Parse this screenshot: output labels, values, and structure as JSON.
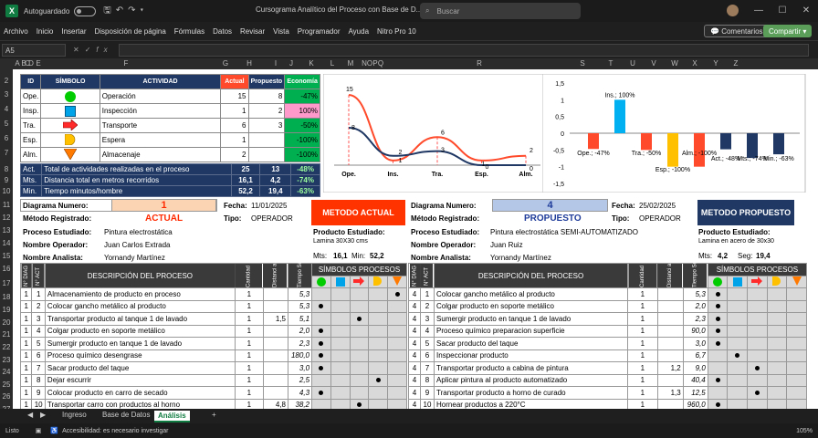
{
  "titlebar": {
    "autosave": "Autoguardado",
    "doc_title": "Cursograma Analítico del Proceso con Base de D...",
    "search": "Buscar"
  },
  "menu": [
    "Archivo",
    "Inicio",
    "Insertar",
    "Disposición de página",
    "Fórmulas",
    "Datos",
    "Revisar",
    "Vista",
    "Programador",
    "Ayuda",
    "Nitro Pro 10"
  ],
  "buttons": {
    "comments": "Comentarios",
    "share": "Compartir"
  },
  "formula": {
    "namebox": "A5"
  },
  "columns": [
    "A",
    "B",
    "C",
    "D",
    "E",
    "F",
    "G",
    "H",
    "I",
    "J",
    "K",
    "L",
    "M",
    "N",
    "O",
    "P",
    "Q",
    "R",
    "S",
    "T",
    "U",
    "V",
    "W",
    "X",
    "Y",
    "Z"
  ],
  "rows": [
    "1",
    "2",
    "3",
    "4",
    "5",
    "6",
    "7",
    "8",
    "9",
    "10",
    "11",
    "12",
    "13",
    "14",
    "15",
    "16",
    "17",
    "18",
    "19",
    "20",
    "21",
    "22",
    "23",
    "24",
    "25",
    "26",
    "27",
    "28"
  ],
  "summary": {
    "headers": [
      "ID",
      "SÍMBOLO",
      "ACTIVIDAD",
      "Actual",
      "Propuesto",
      "Economía"
    ],
    "items": [
      {
        "id": "Ope.",
        "act": "Operación",
        "actual": "15",
        "prop": "8",
        "eco": "-47%"
      },
      {
        "id": "Insp.",
        "act": "Inspección",
        "actual": "1",
        "prop": "2",
        "eco": "100%"
      },
      {
        "id": "Tra.",
        "act": "Transporte",
        "actual": "6",
        "prop": "3",
        "eco": "-50%"
      },
      {
        "id": "Esp.",
        "act": "Espera",
        "actual": "1",
        "prop": "",
        "eco": "-100%"
      },
      {
        "id": "Alm.",
        "act": "Almacenaje",
        "actual": "2",
        "prop": "",
        "eco": "-100%"
      }
    ],
    "totals": [
      {
        "id": "Act.",
        "label": "Total de actividades realizadas en el proceso",
        "a": "25",
        "p": "13",
        "e": "-48%"
      },
      {
        "id": "Mts.",
        "label": "Distancia total en metros recorridos",
        "a": "16,1",
        "p": "4,2",
        "e": "-74%"
      },
      {
        "id": "Min.",
        "label": "Tiempo minutos/hombre",
        "a": "52,2",
        "p": "19,4",
        "e": "-63%"
      }
    ]
  },
  "chart_data": [
    {
      "type": "line",
      "categories": [
        "Ope.",
        "Ins.",
        "Tra.",
        "Esp.",
        "Alm."
      ],
      "series": [
        {
          "values": [
            15,
            1,
            6,
            1,
            2
          ],
          "color": "#ff4b2b"
        },
        {
          "values": [
            8,
            2,
            3,
            0,
            0
          ],
          "color": "#1f3864"
        }
      ],
      "data_labels": [
        "15",
        "8",
        "1",
        "2",
        "6",
        "3",
        "1",
        "0",
        "2",
        "0"
      ]
    },
    {
      "type": "bar",
      "categories": [
        "Ope.; -47%",
        "Ins.; 100%",
        "Tra.; -50%",
        "Esp.; -100%",
        "Alm.; -100%",
        "Act.; -48%",
        "Mts.; -74%",
        "Min.; -63%"
      ],
      "values": [
        -0.47,
        1.0,
        -0.5,
        -1.0,
        -1.0,
        -0.48,
        -0.74,
        -0.63
      ],
      "colors": [
        "#ff4b2b",
        "#00b0f0",
        "#ff4b2b",
        "#ffc000",
        "#ff4b2b",
        "#1f3864",
        "#1f3864",
        "#1f3864"
      ],
      "ylim": [
        -1.5,
        1.5
      ],
      "yticks": [
        "1,5",
        "1",
        "0,5",
        "0",
        "-0,5",
        "-1",
        "-1,5"
      ]
    }
  ],
  "left": {
    "diagram_label": "Diagrama Numero:",
    "diagram_num": "1",
    "date_label": "Fecha:",
    "date": "11/01/2025",
    "method_label": "Método Registrado:",
    "method": "ACTUAL",
    "type_label": "Tipo:",
    "type": "OPERADOR",
    "process_label": "Proceso Estudiado:",
    "process": "Pintura electrostática",
    "operator_label": "Nombre Operador:",
    "operator": "Juan Carlos Extrada",
    "analyst_label": "Nombre Analista:",
    "analyst": "Yornandy Martínez",
    "box_title": "METODO ACTUAL",
    "product_label": "Producto Estudiado:",
    "product": "Lamina 30X30 cms",
    "mts_label": "Mts:",
    "mts": "16,1",
    "min_label": "Min:",
    "min": "52,2",
    "rows": [
      {
        "n": "1",
        "a": "1",
        "d": "Almacenamiento de producto en proceso",
        "q": "1",
        "dist": "",
        "t": "5,3",
        "s": 4
      },
      {
        "n": "1",
        "a": "2",
        "d": "Colocar gancho metálico al producto",
        "q": "1",
        "dist": "",
        "t": "5,3",
        "s": 0
      },
      {
        "n": "1",
        "a": "3",
        "d": "Transportar producto al tanque 1 de lavado",
        "q": "1",
        "dist": "1,5",
        "t": "5,1",
        "s": 2
      },
      {
        "n": "1",
        "a": "4",
        "d": "Colgar producto en soporte metálico",
        "q": "1",
        "dist": "",
        "t": "2,0",
        "s": 0
      },
      {
        "n": "1",
        "a": "5",
        "d": "Sumergir producto en tanque 1 de lavado",
        "q": "1",
        "dist": "",
        "t": "2,3",
        "s": 0
      },
      {
        "n": "1",
        "a": "6",
        "d": "Proceso químico desengrase",
        "q": "1",
        "dist": "",
        "t": "180,0",
        "s": 0
      },
      {
        "n": "1",
        "a": "7",
        "d": "Sacar producto del taque",
        "q": "1",
        "dist": "",
        "t": "3,0",
        "s": 0
      },
      {
        "n": "1",
        "a": "8",
        "d": "Dejar escurrir",
        "q": "1",
        "dist": "",
        "t": "2,5",
        "s": 3
      },
      {
        "n": "1",
        "a": "9",
        "d": "Colocar producto en carro de secado",
        "q": "1",
        "dist": "",
        "t": "4,3",
        "s": 0
      },
      {
        "n": "1",
        "a": "10",
        "d": "Transportar carro con productos al horno",
        "q": "1",
        "dist": "4,8",
        "t": "38,2",
        "s": 2
      }
    ]
  },
  "right": {
    "diagram_label": "Diagrama Numero:",
    "diagram_num": "4",
    "date_label": "Fecha:",
    "date": "25/02/2025",
    "method_label": "Método Registrado:",
    "method": "PROPUESTO",
    "type_label": "Tipo:",
    "type": "OPERADOR",
    "process_label": "Proceso Estudiado:",
    "process": "Pintura electrostática SEMI-AUTOMATIZADO",
    "operator_label": "Nombre Operador:",
    "operator": "Juan Ruiz",
    "analyst_label": "Nombre Analista:",
    "analyst": "Yornandy Martínez",
    "box_title": "METODO PROPUESTO",
    "product_label": "Producto Estudiado:",
    "product": "Lamina en acero de 30x30",
    "mts_label": "Mts:",
    "mts": "4,2",
    "min_label": "Seg:",
    "min": "19,4",
    "rows": [
      {
        "n": "4",
        "a": "1",
        "d": "Colocar gancho metálico al producto",
        "q": "1",
        "dist": "",
        "t": "5,3",
        "s": 0
      },
      {
        "n": "4",
        "a": "2",
        "d": "Colgar producto en soporte metálico",
        "q": "1",
        "dist": "",
        "t": "2,0",
        "s": 0
      },
      {
        "n": "4",
        "a": "3",
        "d": "Sumergir producto en tanque 1 de lavado",
        "q": "1",
        "dist": "",
        "t": "2,3",
        "s": 0
      },
      {
        "n": "4",
        "a": "4",
        "d": "Proceso químico preparacion superficie",
        "q": "1",
        "dist": "",
        "t": "90,0",
        "s": 0
      },
      {
        "n": "4",
        "a": "5",
        "d": "Sacar producto del taque",
        "q": "1",
        "dist": "",
        "t": "3,0",
        "s": 0
      },
      {
        "n": "4",
        "a": "6",
        "d": "Inspeccionar producto",
        "q": "1",
        "dist": "",
        "t": "6,7",
        "s": 1
      },
      {
        "n": "4",
        "a": "7",
        "d": "Transportar producto a cabina de pintura",
        "q": "1",
        "dist": "1,2",
        "t": "9,0",
        "s": 2
      },
      {
        "n": "4",
        "a": "8",
        "d": "Aplicar pintura al producto automatizado",
        "q": "1",
        "dist": "",
        "t": "40,4",
        "s": 0
      },
      {
        "n": "4",
        "a": "9",
        "d": "Transportar producto a horno de curado",
        "q": "1",
        "dist": "1,3",
        "t": "12,5",
        "s": 2
      },
      {
        "n": "4",
        "a": "10",
        "d": "Hornear productos a 220°C",
        "q": "1",
        "dist": "",
        "t": "960,0",
        "s": 0
      }
    ]
  },
  "table_headers": {
    "diag": "N° DIAG",
    "act": "N° ACT",
    "desc": "DESCRIPCIÓN DEL PROCESO",
    "qty": "Cantidad",
    "dist": "Distanci a metros",
    "time": "Tiempo Seg.",
    "symbols": "SÍMBOLOS PROCESOS"
  },
  "sheets": [
    "Ingreso",
    "Base de Datos",
    "Análisis"
  ],
  "status": {
    "ready": "Listo",
    "accessibility": "Accesibilidad: es necesario investigar",
    "zoom": "105%"
  }
}
